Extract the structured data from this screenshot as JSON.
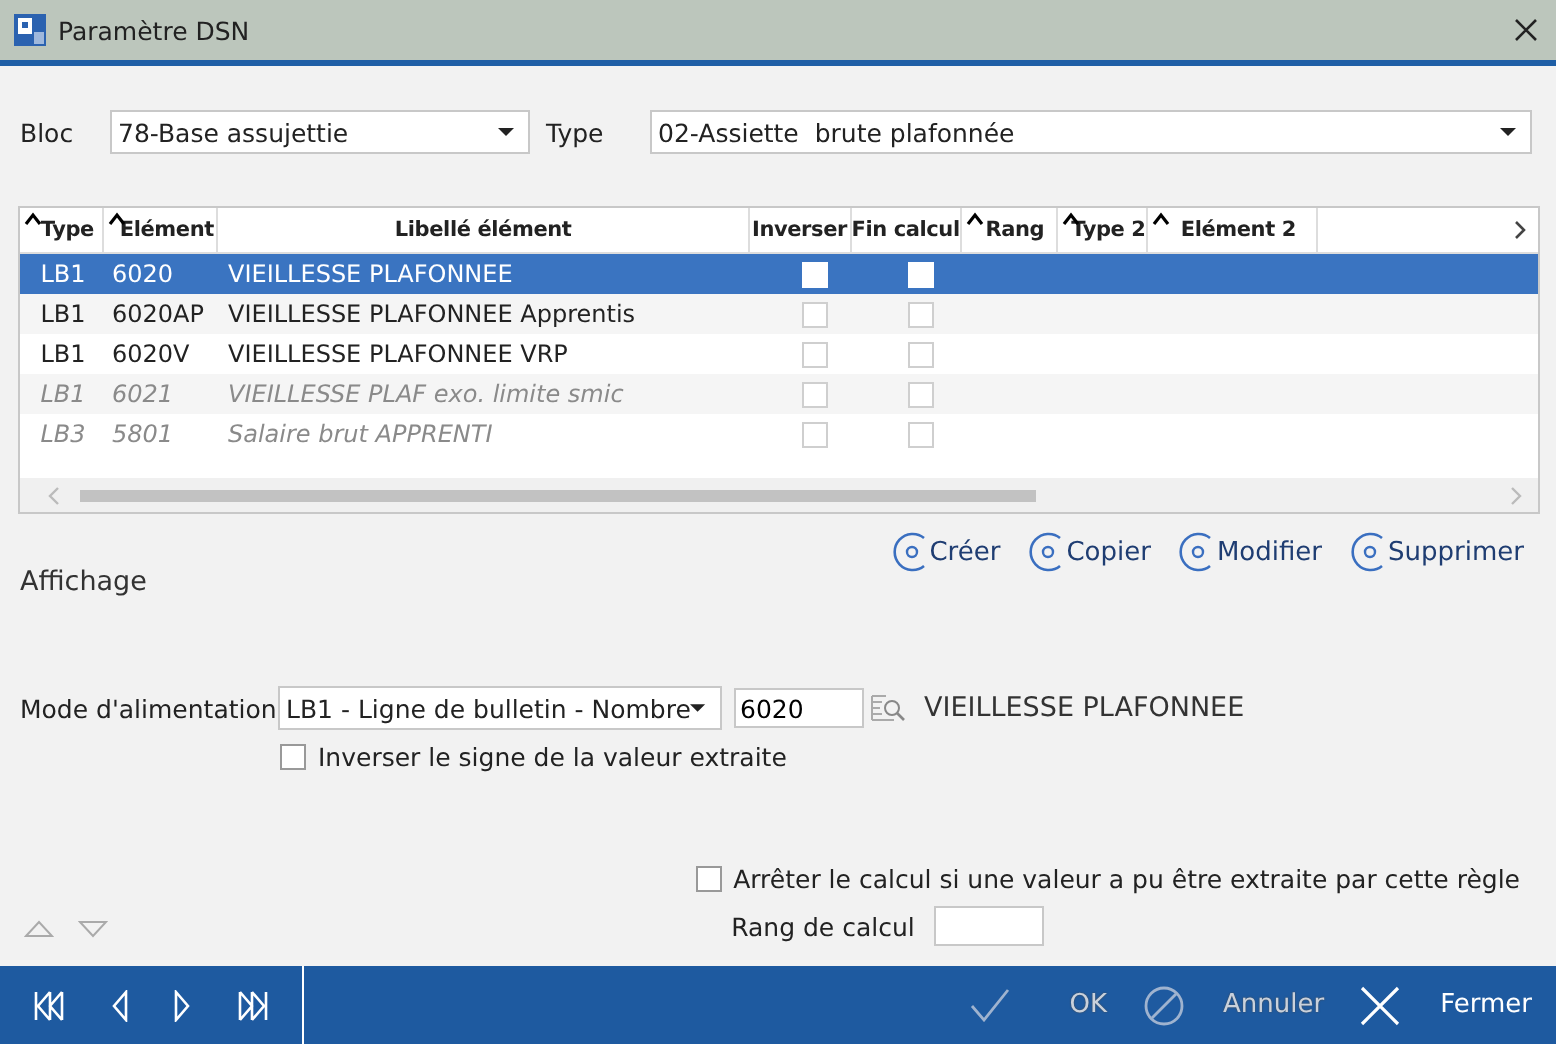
{
  "window": {
    "title": "Paramètre DSN"
  },
  "filters": [
    {
      "label": "Bloc",
      "value": "78-Base assujettie"
    },
    {
      "label": "Type",
      "value": "02-Assiette  brute plafonnée"
    }
  ],
  "grid": {
    "columns": [
      {
        "label": "Type",
        "sortable": true
      },
      {
        "label": "Elément",
        "sortable": true
      },
      {
        "label": "Libellé élément",
        "sortable": false
      },
      {
        "label": "Inverser",
        "sortable": false
      },
      {
        "label": "Fin calcul",
        "sortable": false
      },
      {
        "label": "Rang",
        "sortable": true
      },
      {
        "label": "Type 2",
        "sortable": true
      },
      {
        "label": "Elément 2",
        "sortable": true
      }
    ],
    "rows": [
      {
        "type": "LB1",
        "element": "6020",
        "libelle": "VIEILLESSE PLAFONNEE",
        "inverser": false,
        "fin_calcul": false,
        "selected": true,
        "disabled": false
      },
      {
        "type": "LB1",
        "element": "6020AP",
        "libelle": "VIEILLESSE PLAFONNEE Apprentis",
        "inverser": false,
        "fin_calcul": false,
        "selected": false,
        "disabled": false
      },
      {
        "type": "LB1",
        "element": "6020V",
        "libelle": "VIEILLESSE PLAFONNEE VRP",
        "inverser": false,
        "fin_calcul": false,
        "selected": false,
        "disabled": false
      },
      {
        "type": "LB1",
        "element": "6021",
        "libelle": "VIEILLESSE PLAF exo. limite smic",
        "inverser": false,
        "fin_calcul": false,
        "selected": false,
        "disabled": true
      },
      {
        "type": "LB3",
        "element": "5801",
        "libelle": "Salaire brut APPRENTI",
        "inverser": false,
        "fin_calcul": false,
        "selected": false,
        "disabled": true
      }
    ]
  },
  "actions": [
    "Créer",
    "Copier",
    "Modifier",
    "Supprimer"
  ],
  "section_title": "Affichage",
  "mode": {
    "label": "Mode d'alimentation",
    "value": "LB1 - Ligne de bulletin - Nombre",
    "code": "6020",
    "code_label": "VIEILLESSE PLAFONNEE"
  },
  "invert_sign": {
    "label": "Inverser le signe de la valeur extraite",
    "checked": false
  },
  "stop_calc": {
    "label": "Arrêter le calcul si une valeur a pu être extraite par cette règle",
    "checked": false
  },
  "rank": {
    "label": "Rang de calcul"
  },
  "footer": {
    "buttons": [
      {
        "label": "OK",
        "kind": "ok",
        "disabled": true
      },
      {
        "label": "Annuler",
        "kind": "cancel",
        "disabled": true
      },
      {
        "label": "Fermer",
        "kind": "close",
        "disabled": false
      }
    ]
  }
}
